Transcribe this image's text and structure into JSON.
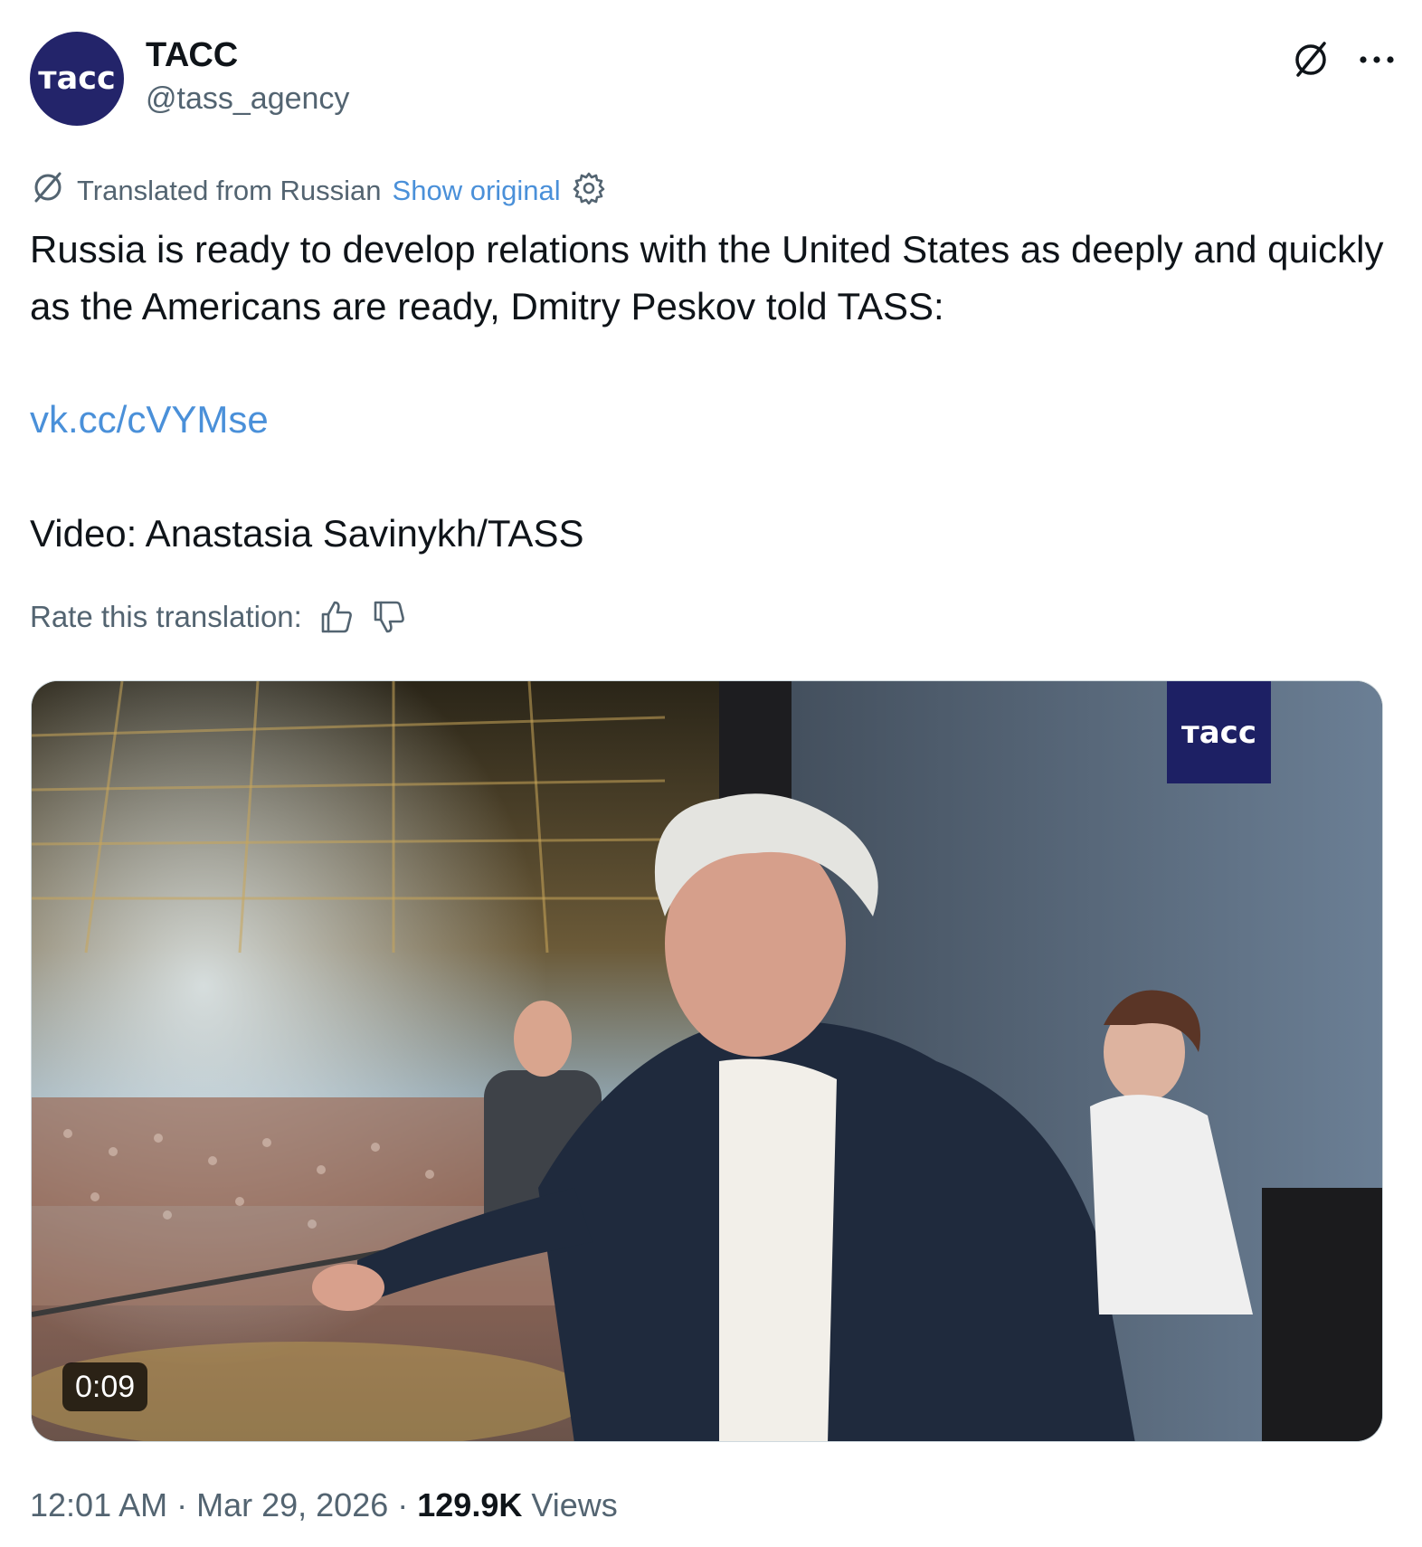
{
  "author": {
    "avatar_text": "тасс",
    "display_name": "ТАСС",
    "handle": "@tass_agency"
  },
  "icons": {
    "translate": "translate-icon",
    "more": "more-icon",
    "gear": "gear-icon",
    "thumbs_up": "thumbs-up-icon",
    "thumbs_down": "thumbs-down-icon"
  },
  "translation": {
    "label": "Translated from Russian",
    "show_original": "Show original"
  },
  "tweet": {
    "text": "Russia is ready to develop relations with the United States as deeply and quickly as the Americans are ready, Dmitry Peskov told TASS:",
    "link": "vk.cc/cVYMse",
    "credit": "Video: Anastasia Savinykh/TASS"
  },
  "rating": {
    "label": "Rate this translation:"
  },
  "media": {
    "watermark": "тасс",
    "duration": "0:09"
  },
  "meta": {
    "time": "12:01 AM",
    "date": "Mar 29, 2026",
    "separator": "·",
    "views_count": "129.9K",
    "views_label": "Views"
  },
  "colors": {
    "link": "#4a90d9",
    "brand_navy": "#23246a",
    "secondary_text": "#536471"
  }
}
